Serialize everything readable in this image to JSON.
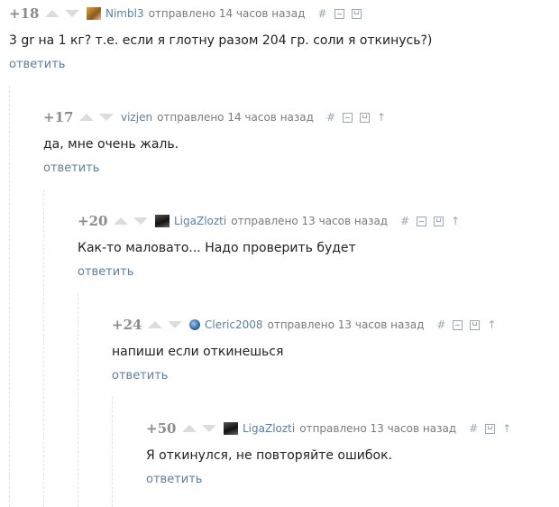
{
  "comments": [
    {
      "rating": "+18",
      "user": "Nimbl3",
      "meta": "отправлено 14 часов назад",
      "tools": {
        "hash": "#"
      },
      "text": "3 gr на 1 кг? т.е. если я глотну разом 204 гр. соли я откинусь?)",
      "reply": "ответить",
      "avatar_color": "#b8862f"
    },
    {
      "rating": "+17",
      "user": "vizjen",
      "meta": "отправлено 14 часов назад",
      "tools": {
        "hash": "#",
        "up": "↑"
      },
      "text": "да, мне очень жаль.",
      "reply": "ответить"
    },
    {
      "rating": "+20",
      "user": "LigaZlozti",
      "meta": "отправлено 13 часов назад",
      "tools": {
        "hash": "#",
        "up": "↑"
      },
      "text": "Как-то маловато... Надо проверить будет",
      "reply": "ответить",
      "avatar_color": "#2a2a2a"
    },
    {
      "rating": "+24",
      "user": "Cleric2008",
      "meta": "отправлено 13 часов назад",
      "tools": {
        "hash": "#",
        "up": "↑"
      },
      "text": "напиши если откинешься",
      "reply": "ответить",
      "avatar_color": "#3a6fa8"
    },
    {
      "rating": "+50",
      "user": "LigaZlozti",
      "meta": "отправлено 13 часов назад",
      "tools": {
        "hash": "#",
        "up": "↑"
      },
      "text": "Я откинулся, не повторяйте ошибок.",
      "reply": "ответить",
      "avatar_color": "#2a2a2a"
    }
  ],
  "colors": {
    "link": "#5c7fa0",
    "rating": "#8c8c8c",
    "meta": "#7a7a7a",
    "text": "#222222",
    "thread_line": "#e3e3e3"
  }
}
